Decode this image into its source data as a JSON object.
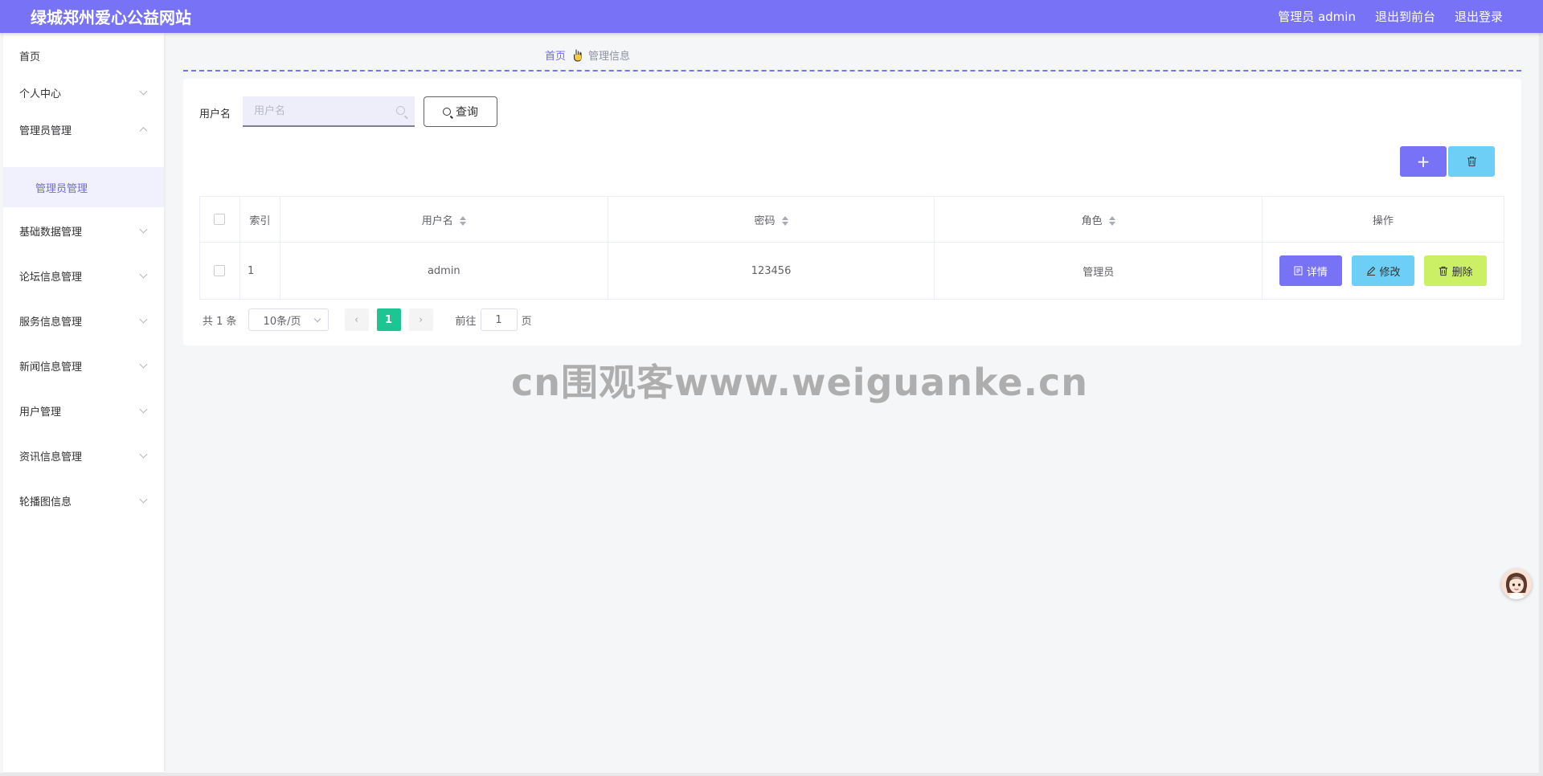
{
  "header": {
    "site_title": "绿城郑州爱心公益网站",
    "admin_label": "管理员 admin",
    "to_front": "退出到前台",
    "logout": "退出登录",
    "brand_color": "#7872f7"
  },
  "sidebar": {
    "items": [
      {
        "label": "首页"
      },
      {
        "label": "个人中心"
      },
      {
        "label": "管理员管理",
        "expanded": true
      },
      {
        "label": "基础数据管理"
      },
      {
        "label": "论坛信息管理"
      },
      {
        "label": "服务信息管理"
      },
      {
        "label": "新闻信息管理"
      },
      {
        "label": "用户管理"
      },
      {
        "label": "资讯信息管理"
      },
      {
        "label": "轮播图信息"
      }
    ],
    "sub_item": "管理员管理"
  },
  "breadcrumb": {
    "home": "首页",
    "current": "管理信息"
  },
  "search": {
    "label": "用户名",
    "placeholder": "用户名",
    "value": "",
    "query_button": "查询"
  },
  "toolbar": {
    "add_icon": "plus-icon",
    "delete_icon": "trash-icon"
  },
  "table": {
    "columns": [
      "索引",
      "用户名",
      "密码",
      "角色",
      "操作"
    ],
    "rows": [
      {
        "index": "1",
        "username": "admin",
        "password": "123456",
        "role": "管理员"
      }
    ],
    "actions": {
      "detail": "详情",
      "edit": "修改",
      "delete": "删除"
    }
  },
  "pagination": {
    "total": "共 1 条",
    "page_size": "10条/页",
    "current_page": "1",
    "goto_prefix": "前往",
    "goto_value": "1",
    "goto_suffix": "页"
  },
  "watermark": "cn围观客www.weiguanke.cn"
}
